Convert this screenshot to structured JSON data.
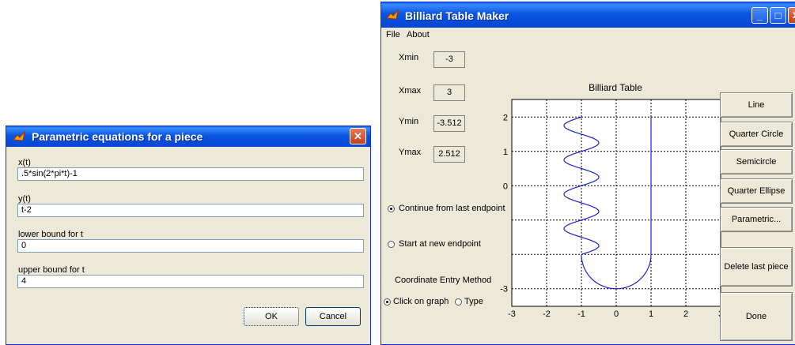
{
  "dialog": {
    "title": "Parametric equations for a piece",
    "fields": [
      {
        "label": "x(t)",
        "value": ".5*sin(2*pi*t)-1"
      },
      {
        "label": "y(t)",
        "value": "t-2"
      },
      {
        "label": "lower bound for t",
        "value": "0"
      },
      {
        "label": "upper bound for t",
        "value": "4"
      }
    ],
    "ok_label": "OK",
    "cancel_label": "Cancel",
    "close_icon": "close-icon"
  },
  "window": {
    "title": "Billiard Table Maker",
    "menu": [
      "File",
      "About"
    ],
    "bounds": [
      {
        "label": "Xmin",
        "value": "-3"
      },
      {
        "label": "Xmax",
        "value": "3"
      },
      {
        "label": "Ymin",
        "value": "-3.512"
      },
      {
        "label": "Ymax",
        "value": "2.512"
      }
    ],
    "continue_label": "Continue from last endpoint",
    "start_label": "Start at new endpoint",
    "coord_method_label": "Coordinate Entry Method",
    "click_label": "Click on graph",
    "type_label": "Type",
    "buttons": [
      "Line",
      "Quarter Circle",
      "Semicircle",
      "Quarter Ellipse",
      "Parametric...",
      "Delete last piece",
      "Done"
    ]
  },
  "chart_data": {
    "type": "line",
    "title": "Billiard Table",
    "xlabel": "",
    "ylabel": "",
    "xlim": [
      -3,
      3
    ],
    "ylim": [
      -3.512,
      2.512
    ],
    "x_ticks": [
      "-3",
      "-2",
      "-1",
      "0",
      "1",
      "2",
      "3"
    ],
    "y_ticks": [
      "-3",
      "",
      "",
      "0",
      "1",
      "2"
    ],
    "grid": true,
    "series": [
      {
        "color": "#1f1fcf",
        "description_points": [
          [
            1,
            2
          ],
          [
            1,
            -2
          ]
        ]
      }
    ],
    "curve": {
      "x": ".5*sin(2*pi*t)-1",
      "y": "t-2",
      "t_range": [
        0,
        4
      ]
    },
    "semicircle": {
      "center": [
        0,
        -2
      ],
      "radius": 1
    }
  }
}
